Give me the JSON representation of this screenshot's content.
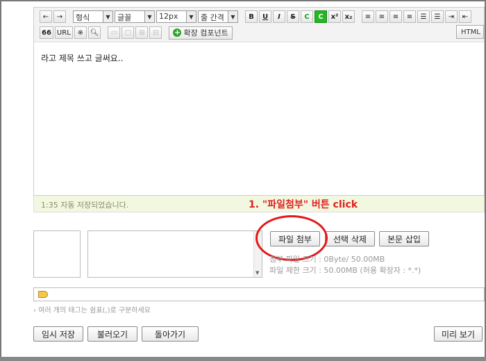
{
  "toolbar": {
    "format_select": "형식",
    "font_select": "글꼴",
    "size_select": "12px",
    "line_select": "줄 간격",
    "extension_label": "확장 컴포넌트",
    "html_label": "HTML",
    "quote_label": "66",
    "url_label": "URL",
    "bold": "B",
    "underline": "U",
    "italic": "I",
    "strike": "S",
    "sup": "x²",
    "sub": "x₂"
  },
  "editor": {
    "content": "라고 제목 쓰고 글써요..",
    "autosave": "1:35 자동 저장되었습니다."
  },
  "annotation": "1. \"파일첨부\" 버튼 click",
  "attachments": {
    "attach_button": "파일 첨부",
    "delete_button": "선택 삭제",
    "insert_button": "본문 삽입",
    "attached_info": "첨부 파일 크기 : 0Byte/ 50.00MB",
    "limit_info": "파일 제한 크기 : 50.00MB (허용 확장자 : *.*)"
  },
  "tags": {
    "hint": "› 여러 개의 태그는 쉼표(,)로 구분하세요"
  },
  "actions": {
    "temp_save": "임시 저장",
    "load": "불러오기",
    "back": "돌아가기",
    "preview": "미리 보기"
  },
  "colors": {
    "annotation": "#e02020",
    "autosave_bg": "#f2f8df"
  }
}
